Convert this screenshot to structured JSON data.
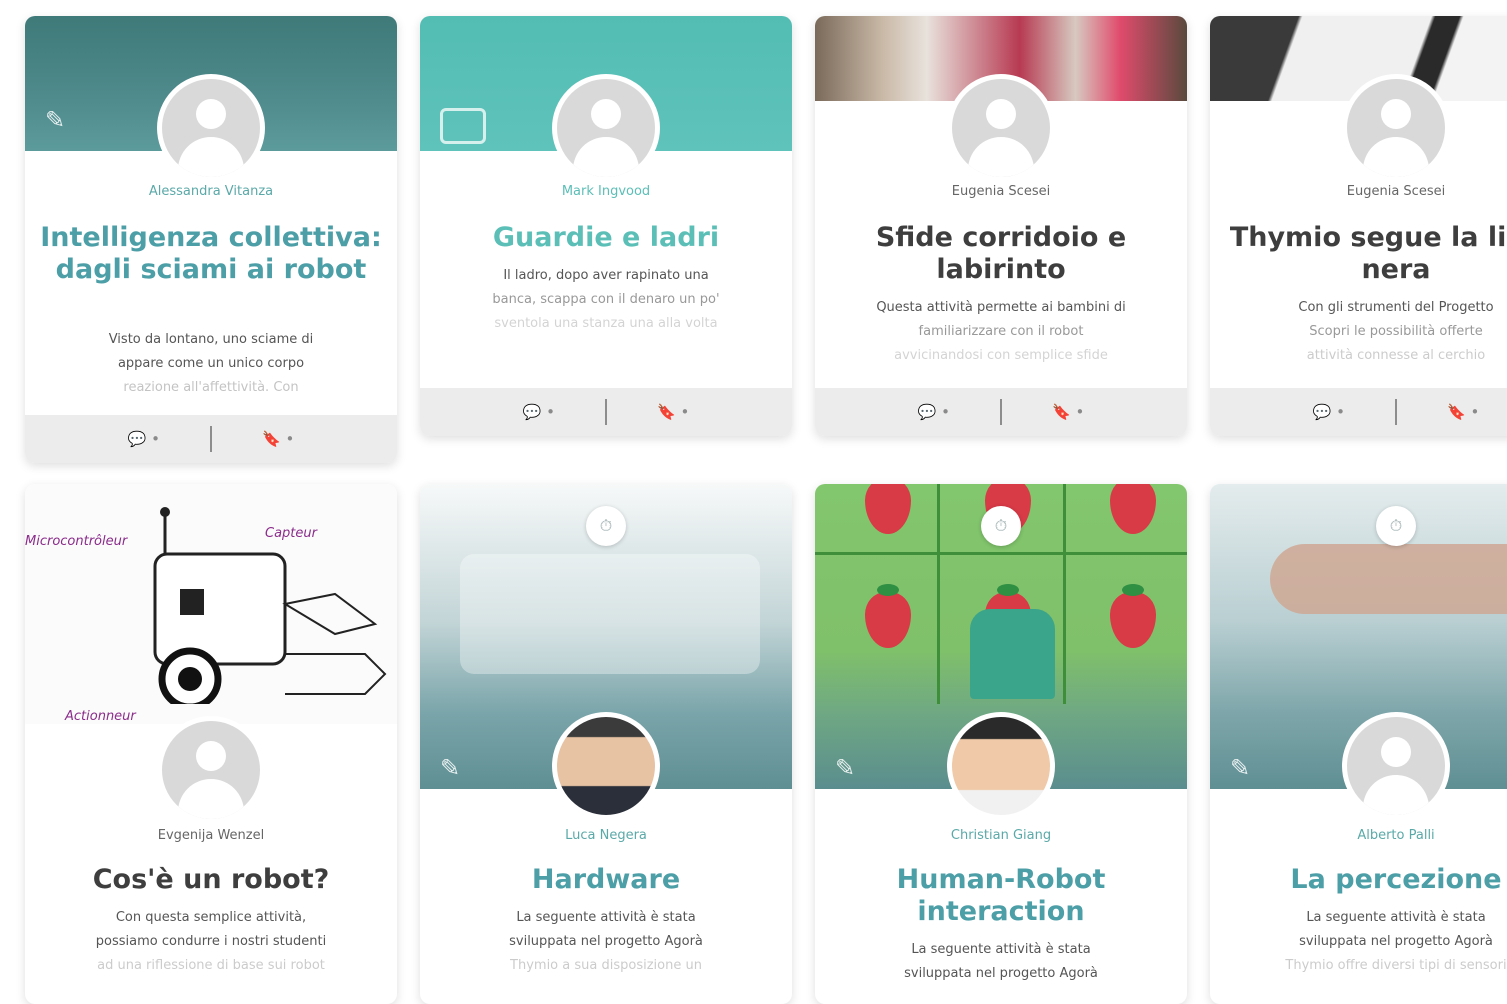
{
  "cards": [
    {
      "author": "Alessandra Vitanza",
      "title": "Intelligenza collettiva: dagli sciami ai robot",
      "desc_line1": "Visto da lontano, uno sciame di",
      "desc_line2": "appare come un unico corpo",
      "desc_line3": "reazione all'affettività. Con",
      "comments": "•",
      "saves": "•"
    },
    {
      "author": "Mark Ingvood",
      "title": "Guardie e ladri",
      "desc_line1": "Il ladro, dopo aver rapinato una",
      "desc_line2": "banca, scappa con il denaro un po'",
      "desc_line3": "sventola una stanza una alla volta",
      "comments": "•",
      "saves": "•"
    },
    {
      "author": "Eugenia Scesei",
      "title": "Sfide corridoio e labirinto",
      "desc_line1": "Questa attività permette ai bambini di",
      "desc_line2": "familiarizzare con il robot",
      "desc_line3": "avvicinandosi con semplice sfide",
      "comments": "•",
      "saves": "•"
    },
    {
      "author": "Eugenia Scesei",
      "title": "Thymio segue la linea nera",
      "desc_line1": "Con gli strumenti del Progetto",
      "desc_line2": "Scopri le possibilità offerte",
      "desc_line3": "attività connesse al cerchio",
      "comments": "•",
      "saves": "•"
    },
    {
      "author": "Evgenija Wenzel",
      "title": "Cos'è un robot?",
      "desc_line1": "Con questa semplice attività,",
      "desc_line2": "possiamo condurre i nostri studenti",
      "desc_line3": "ad una riflessione di base sui robot",
      "sketch_labels": [
        "Microcontrôleur",
        "Capteur",
        "Actionneur"
      ]
    },
    {
      "author": "Luca Negera",
      "title": "Hardware",
      "desc_line1": "La seguente attività è stata",
      "desc_line2": "sviluppata nel progetto Agorà",
      "desc_line3": "Thymio a sua disposizione un"
    },
    {
      "author": "Christian Giang",
      "title": "Human-Robot interaction",
      "desc_line1": "La seguente attività è stata",
      "desc_line2": "sviluppata nel progetto Agorà",
      "desc_line3": ""
    },
    {
      "author": "Alberto Palli",
      "title": "La percezione",
      "desc_line1": "La seguente attività è stata",
      "desc_line2": "sviluppata nel progetto Agorà",
      "desc_line3": "Thymio offre diversi tipi di sensori"
    }
  ]
}
